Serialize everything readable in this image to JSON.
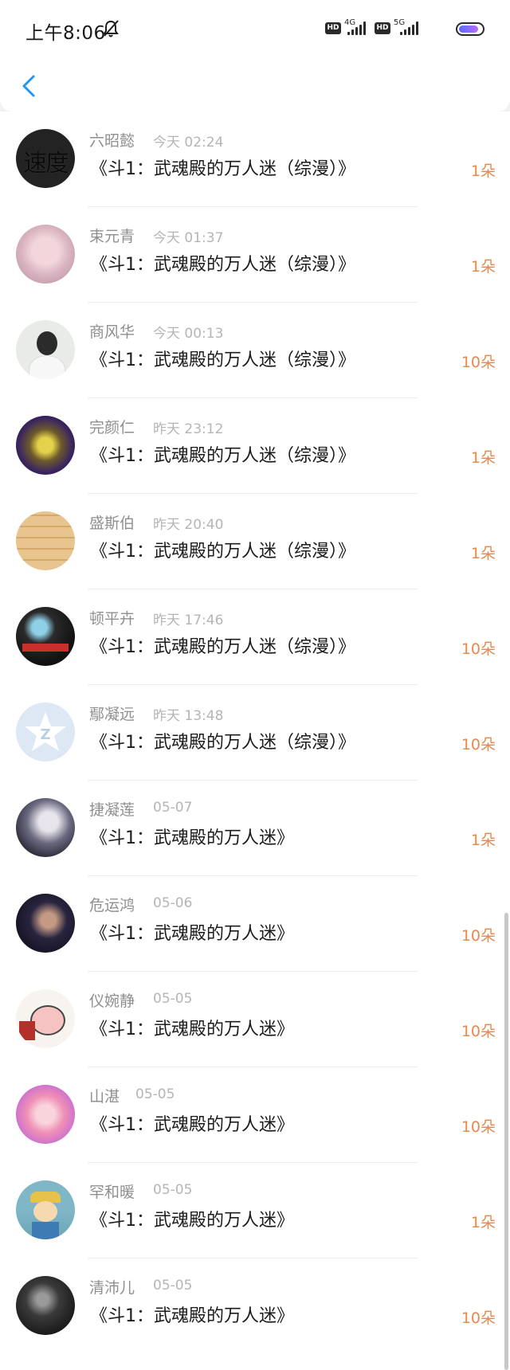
{
  "status_bar": {
    "time": "上午8:06",
    "hd_badge": "HD",
    "network_1": "4G",
    "network_2": "5G"
  },
  "nav": {
    "back_icon": "chevron-left-icon",
    "accent_color": "#2196f3"
  },
  "theme": {
    "amount_color": "#e8884d"
  },
  "gifts": [
    {
      "name": "六昭懿",
      "time": "今天 02:24",
      "book": "《斗1：武魂殿的万人迷（综漫）》",
      "amount": "1朵",
      "avatar_text": "速度"
    },
    {
      "name": "束元青",
      "time": "今天 01:37",
      "book": "《斗1：武魂殿的万人迷（综漫）》",
      "amount": "1朵"
    },
    {
      "name": "商风华",
      "time": "今天 00:13",
      "book": "《斗1：武魂殿的万人迷（综漫）》",
      "amount": "10朵"
    },
    {
      "name": "完颜仁",
      "time": "昨天 23:12",
      "book": "《斗1：武魂殿的万人迷（综漫）》",
      "amount": "1朵"
    },
    {
      "name": "盛斯伯",
      "time": "昨天 20:40",
      "book": "《斗1：武魂殿的万人迷（综漫）》",
      "amount": "1朵"
    },
    {
      "name": "顿平卉",
      "time": "昨天 17:46",
      "book": "《斗1：武魂殿的万人迷（综漫）》",
      "amount": "10朵"
    },
    {
      "name": "鄢凝远",
      "time": "昨天 13:48",
      "book": "《斗1：武魂殿的万人迷（综漫）》",
      "amount": "10朵"
    },
    {
      "name": "捷凝莲",
      "time": "05-07",
      "book": "《斗1：武魂殿的万人迷》",
      "amount": "1朵"
    },
    {
      "name": "危运鸿",
      "time": "05-06",
      "book": "《斗1：武魂殿的万人迷》",
      "amount": "10朵"
    },
    {
      "name": "仪婉静",
      "time": "05-05",
      "book": "《斗1：武魂殿的万人迷》",
      "amount": "10朵"
    },
    {
      "name": "山湛",
      "time": "05-05",
      "book": "《斗1：武魂殿的万人迷》",
      "amount": "10朵"
    },
    {
      "name": "罕和暖",
      "time": "05-05",
      "book": "《斗1：武魂殿的万人迷》",
      "amount": "1朵"
    },
    {
      "name": "清沛儿",
      "time": "05-05",
      "book": "《斗1：武魂殿的万人迷》",
      "amount": "10朵"
    }
  ]
}
